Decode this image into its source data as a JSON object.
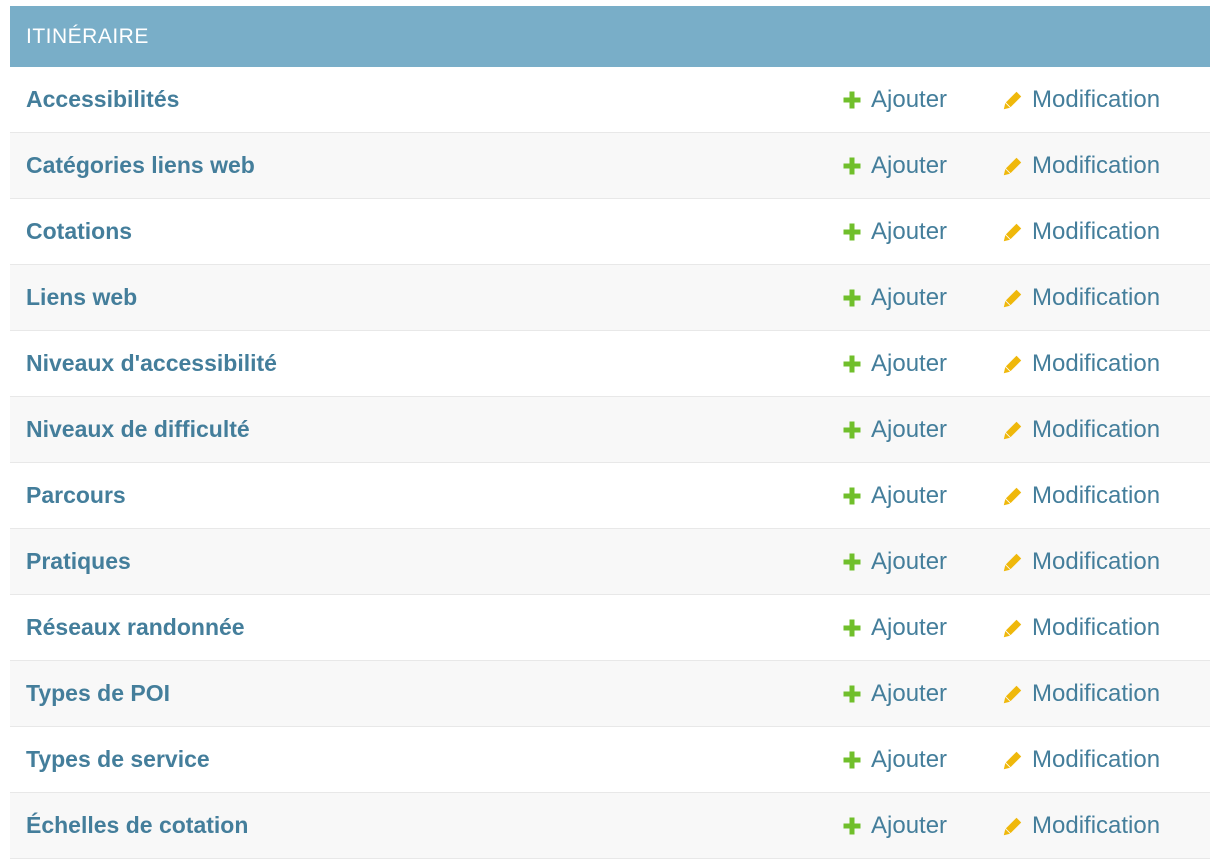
{
  "module": {
    "caption": "ITINÉRAIRE"
  },
  "colors": {
    "header_bg": "#79aec8",
    "link": "#447e9b",
    "add_icon": "#70bf2b",
    "change_icon": "#efb80b"
  },
  "icons": {
    "add": "plus-icon",
    "change": "pencil-icon"
  },
  "rows": [
    {
      "name": "Accessibilités",
      "add_label": "Ajouter",
      "change_label": "Modification"
    },
    {
      "name": "Catégories liens web",
      "add_label": "Ajouter",
      "change_label": "Modification"
    },
    {
      "name": "Cotations",
      "add_label": "Ajouter",
      "change_label": "Modification"
    },
    {
      "name": "Liens web",
      "add_label": "Ajouter",
      "change_label": "Modification"
    },
    {
      "name": "Niveaux d'accessibilité",
      "add_label": "Ajouter",
      "change_label": "Modification"
    },
    {
      "name": "Niveaux de difficulté",
      "add_label": "Ajouter",
      "change_label": "Modification"
    },
    {
      "name": "Parcours",
      "add_label": "Ajouter",
      "change_label": "Modification"
    },
    {
      "name": "Pratiques",
      "add_label": "Ajouter",
      "change_label": "Modification"
    },
    {
      "name": "Réseaux randonnée",
      "add_label": "Ajouter",
      "change_label": "Modification"
    },
    {
      "name": "Types de POI",
      "add_label": "Ajouter",
      "change_label": "Modification"
    },
    {
      "name": "Types de service",
      "add_label": "Ajouter",
      "change_label": "Modification"
    },
    {
      "name": "Échelles de cotation",
      "add_label": "Ajouter",
      "change_label": "Modification"
    }
  ]
}
